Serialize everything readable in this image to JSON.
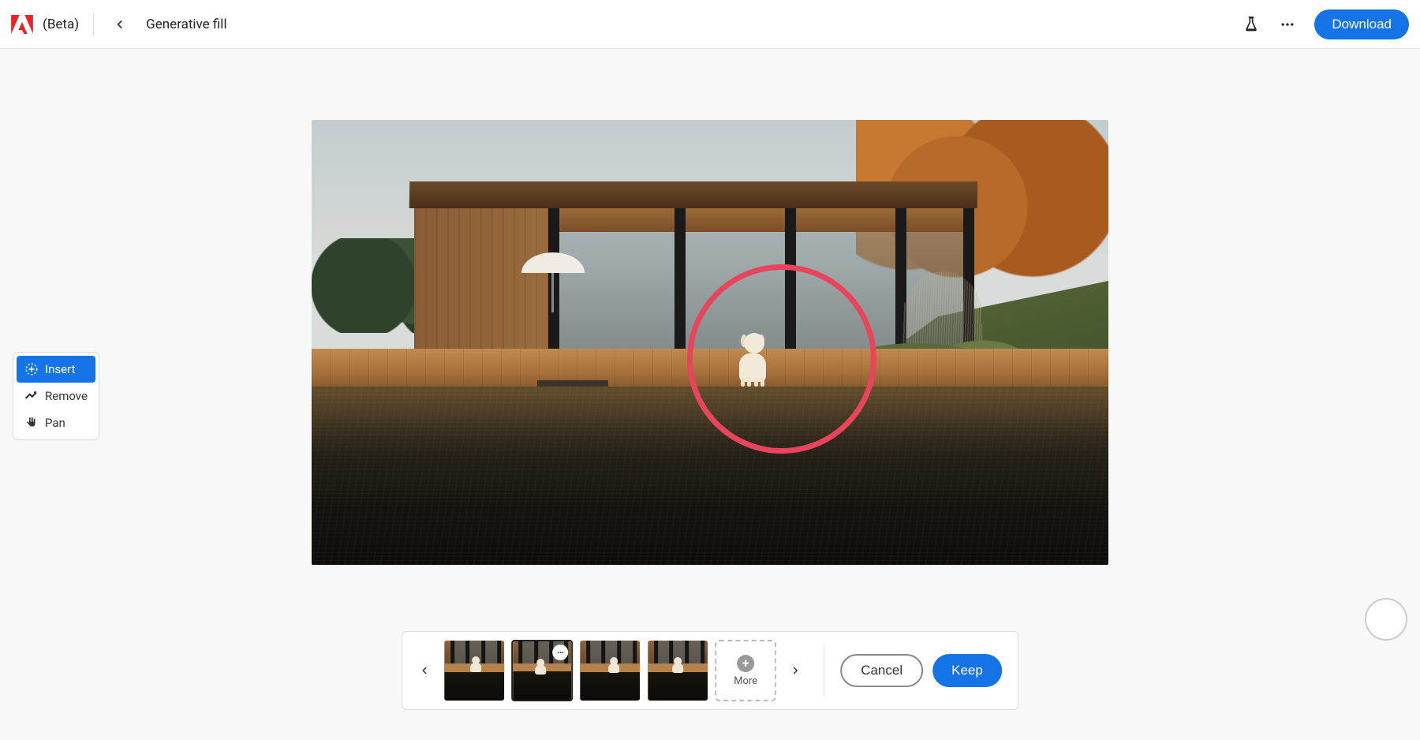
{
  "header": {
    "beta_label": "(Beta)",
    "breadcrumb": "Generative fill",
    "download_label": "Download"
  },
  "toolbar": {
    "insert_label": "Insert",
    "remove_label": "Remove",
    "pan_label": "Pan",
    "active": "insert"
  },
  "variations": {
    "more_label": "More",
    "selected_index": 1,
    "count": 4
  },
  "actions": {
    "cancel_label": "Cancel",
    "keep_label": "Keep"
  }
}
